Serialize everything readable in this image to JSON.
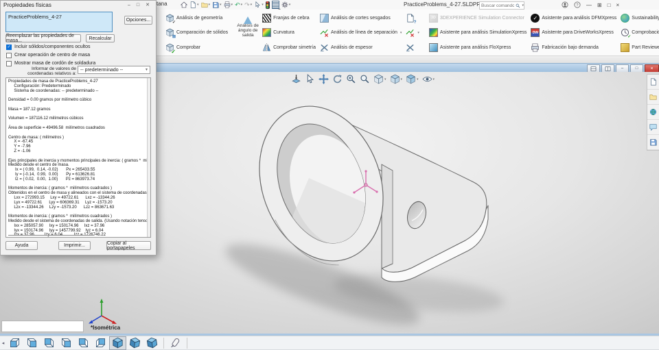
{
  "titlebar": {
    "menu_remnant": "tana",
    "document_title": "PracticeProblems_4-27.SLDPRT",
    "search_placeholder": "Buscar comandos",
    "quick_access_icons": [
      "home-icon",
      "new-document-icon",
      "open-icon",
      "save-icon",
      "print-icon",
      "undo-icon",
      "redo-icon",
      "select-icon",
      "selection-filter-icon",
      "hide-show-tree-icon",
      "options-gear-icon"
    ],
    "window_control_icons": [
      "user-account-icon",
      "help-icon",
      "minimize-icon",
      "fullscreen-icon",
      "restore-icon",
      "close-icon"
    ]
  },
  "ribbon": {
    "items": [
      "Análisis de geometría",
      "Comparación de sólidos",
      "Comprobar",
      "Análisis de ángulo de salida",
      "Franjas de cebra",
      "Curvatura",
      "Comprobar simetría",
      "Análisis de cortes sesgados",
      "Análisis de línea de separación",
      "Análisis de espesor",
      "3DEXPERIENCE Simulation Connector",
      "Asistente para análisis SimulationXpress",
      "Asistente para análisis FloXpress",
      "Asistente para análisis DFMXpress",
      "Asistente para DriveWorksXpress",
      "Fabricación bajo demanda",
      "Sustainability",
      "Comprobación de versión anterior",
      "Part Reviewer"
    ],
    "disabled_item": "3DEXPERIENCE Simulation Connector",
    "unlabeled_tool_icons": [
      "document-check-icon",
      "verify-entities-icon",
      "deviation-analysis-icon"
    ]
  },
  "docframe": {
    "window_control_icons": [
      "split-horizontal-icon",
      "split-vertical-icon",
      "minimize-icon",
      "restore-icon",
      "close-icon"
    ]
  },
  "viewport": {
    "orientation_label": "*Isométrica",
    "headsup_icons": [
      "zoom-to-fit-icon",
      "select-icon",
      "pan-icon",
      "rotate-view-icon",
      "zoom-area-icon",
      "magnify-icon",
      "section-view-icon",
      "view-orientation-icon",
      "display-style-icon",
      "hide-show-items-icon"
    ],
    "taskpane_icons": [
      "resources-icon",
      "design-library-icon",
      "marketplace-globe-icon",
      "comments-icon",
      "appearances-icon"
    ],
    "view_cube_icons": [
      "front-view",
      "back-view",
      "left-view",
      "right-view",
      "top-view",
      "bottom-view",
      "isometric-view",
      "trimetric-view",
      "dimetric-view",
      "normal-to-view"
    ],
    "selected_view": "isometric-view"
  },
  "dialog": {
    "title": "Propiedades físicas",
    "part_name": "PracticeProblems_4-27",
    "options_button": "Opciones...",
    "replace_mass_button": "Reemplazar las propiedades de masa...",
    "recalculate_button": "Recalcular",
    "checkboxes": [
      {
        "label": "Incluir sólidos/componentes ocultos",
        "checked": true
      },
      {
        "label": "Crear operación de centro de masa",
        "checked": false
      },
      {
        "label": "Mostrar masa de cordón de soldadura",
        "checked": false
      }
    ],
    "check_glyph": "✓",
    "coord_label": "Informar de valores de coordenadas relativos a:",
    "coord_value": "-- predeterminado --",
    "report": "Propiedades de masa de PracticeProblems_4-27\n     Configuración: Predeterminado\n     Sistema de coordenadas: -- predeterminado --\n\nDensidad = 0.00 gramos por milímetro cúbico\n\nMasa = 187.12 gramos\n\nVolumen = 187116.12 milímetros cúbicos\n\nÁrea de superficie = 49496.58  milímetros cuadrados\n\nCentro de masa: ( milímetros )\n     X = -67.45\n     Y = -7.96\n     Z = -1.06\n\nEjes principales de inercia y momentos principales de inercia: ( gramos *  milímetros cuadrados )\nMedido desde el centro de masa.\n      Ix = ( 0.99,  0.14, -0.02)       Px = 265433.55\n      Iy = (-0.14,  0.99,  0.00)       Py = 613626.81\n      Iz = ( 0.02,  0.00,  1.00)       Pz = 863973.74\n\nMomentos de inercia: ( gramos *  milímetros cuadrados )\nObtenidos en el centro de masa y alineados con el sistema de coordenadas de salida.\n     Lxx = 272993.15     Lxy = 49722.61      Lxz = -13344.26\n     Lyx = 49722.61      Lyy = 606369.31     Lyz = -1573.20\n     Lzx = -13344.26     Lzy = -1573.20      Lzz = 863671.63\n\nMomentos de inercia: ( gramos *  milímetros cuadrados )\nMedido desde el sistema de coordenadas de salida. (Usando notación tensorial positiva)\n     Ixx = 285057.90     Ixy = 150174.96     Ixz = 37.96\n     Iyx = 150174.96     Iyy = 1457799.92    Iyz = 6.04\n     Izx = 37.96         Izy = 6.04          Izz = 1726746.22",
    "help_button": "Ayuda",
    "print_button": "Imprimir...",
    "copy_button": "Copiar al portapapeles"
  },
  "colors": {
    "accent_blue": "#0b6fd7",
    "frame_blue": "#a9c6e2",
    "close_red": "#c23b33",
    "com_pink": "#d96fae",
    "namebox_blue": "#cfe8f8"
  }
}
